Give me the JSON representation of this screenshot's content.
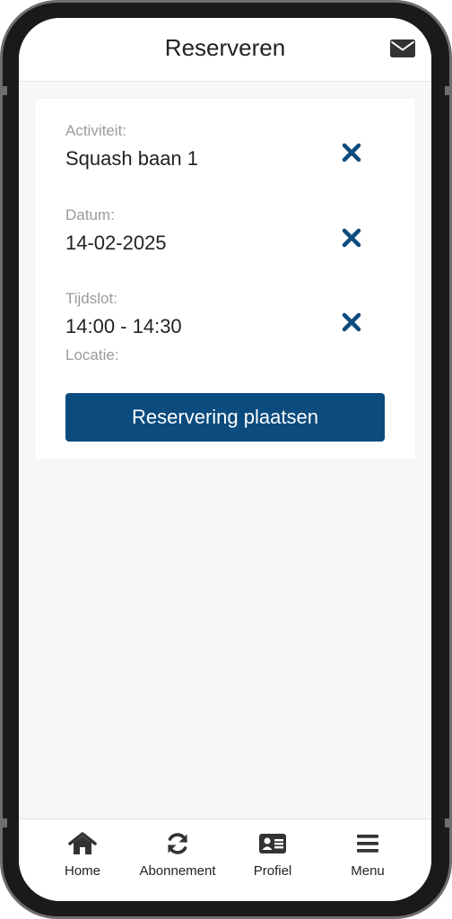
{
  "header": {
    "title": "Reserveren",
    "mail_icon": "envelope-icon"
  },
  "reservation": {
    "activity_label": "Activiteit:",
    "activity_value": "Squash baan 1",
    "date_label": "Datum:",
    "date_value": "14-02-2025",
    "timeslot_label": "Tijdslot:",
    "timeslot_value": "14:00 - 14:30",
    "location_label": "Locatie:",
    "submit_label": "Reservering plaatsen"
  },
  "bottom_nav": {
    "items": [
      {
        "label": "Home",
        "icon": "home-icon"
      },
      {
        "label": "Abonnement",
        "icon": "refresh-icon"
      },
      {
        "label": "Profiel",
        "icon": "id-card-icon"
      },
      {
        "label": "Menu",
        "icon": "hamburger-icon"
      }
    ]
  },
  "colors": {
    "accent": "#0b4b7e",
    "label": "#9b9b9b",
    "text": "#222222",
    "background": "#f7f7f7"
  }
}
